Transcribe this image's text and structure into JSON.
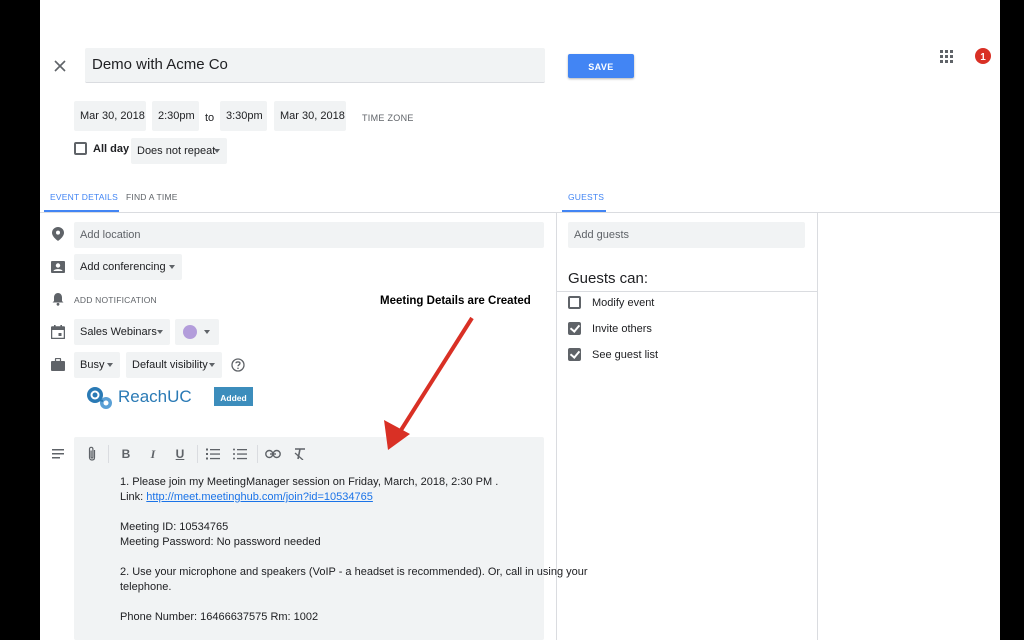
{
  "event": {
    "title": "Demo with Acme Co",
    "save_label": "SAVE",
    "notification_count": "1",
    "start_date": "Mar 30, 2018",
    "start_time": "2:30pm",
    "to_label": "to",
    "end_time": "3:30pm",
    "end_date": "Mar 30, 2018",
    "time_zone_label": "TIME ZONE",
    "all_day_label": "All day",
    "repeat_value": "Does not repeat"
  },
  "tabs": {
    "event_details": "EVENT DETAILS",
    "find_a_time": "FIND A TIME",
    "guests": "GUESTS"
  },
  "details": {
    "location_placeholder": "Add location",
    "conferencing_label": "Add conferencing",
    "add_notification": "ADD NOTIFICATION",
    "calendar_value": "Sales Webinars",
    "calendar_color": "#b39ddb",
    "busy_value": "Busy",
    "visibility_value": "Default visibility",
    "reachuc_label": "ReachUC",
    "added_label": "Added"
  },
  "annotation": {
    "text": "Meeting Details are Created",
    "arrow_color": "#d93025"
  },
  "description": {
    "line1": "1. Please join my MeetingManager session on Friday, March, 2018, 2:30 PM .",
    "link_prefix": "Link: ",
    "link_url": "http://meet.meetinghub.com/join?id=10534765",
    "meeting_id": "Meeting ID: 10534765",
    "meeting_password": "Meeting Password: No password needed",
    "line2a": "2. Use your microphone and speakers (VoIP - a headset is recommended). Or, call in using your",
    "line2b": "telephone.",
    "phone": "Phone Number: 16466637575 Rm: 1002"
  },
  "guests": {
    "placeholder": "Add guests",
    "heading": "Guests can:",
    "options": [
      {
        "label": "Modify event",
        "checked": false
      },
      {
        "label": "Invite others",
        "checked": true
      },
      {
        "label": "See guest list",
        "checked": true
      }
    ]
  },
  "colors": {
    "accent": "#4285f4",
    "badge": "#d93025",
    "added_badge": "#3c8dbc"
  }
}
